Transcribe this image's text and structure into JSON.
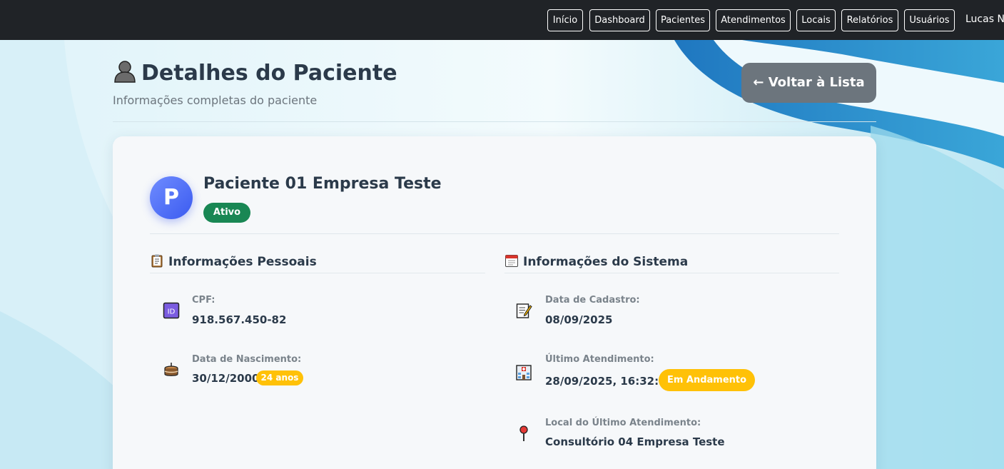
{
  "navbar": {
    "items": [
      {
        "label": "Início"
      },
      {
        "label": "Dashboard"
      },
      {
        "label": "Pacientes"
      },
      {
        "label": "Atendimentos"
      },
      {
        "label": "Locais"
      },
      {
        "label": "Relatórios"
      },
      {
        "label": "Usuários"
      }
    ],
    "user_name": "Lucas N"
  },
  "header": {
    "title": "Detalhes do Paciente",
    "subtitle": "Informações completas do paciente",
    "back_button": "← Voltar à Lista",
    "title_icon": "person-icon"
  },
  "patient": {
    "avatar_letter": "P",
    "name": "Paciente 01 Empresa Teste",
    "status": "Ativo",
    "status_color": "#198754"
  },
  "personal_info": {
    "title": "Informações Pessoais",
    "icon": "clipboard-icon",
    "cpf_label": "CPF:",
    "cpf_value": "918.567.450-82",
    "cpf_icon": "id-icon",
    "birth_label": "Data de Nascimento:",
    "birth_value": "30/12/2000",
    "birth_icon": "cake-icon",
    "age_badge": "24 anos"
  },
  "system_info": {
    "title": "Informações do Sistema",
    "icon": "calendar-icon",
    "created_label": "Data de Cadastro:",
    "created_value": "08/09/2025",
    "created_icon": "memo-icon",
    "last_attend_label": "Último Atendimento:",
    "last_attend_value": "28/09/2025, 16:32:00",
    "last_attend_icon": "hospital-icon",
    "last_attend_status": "Em Andamento",
    "last_location_label": "Local do Último Atendimento:",
    "last_location_value": "Consultório 04 Empresa Teste",
    "last_location_icon": "pushpin-icon"
  },
  "colors": {
    "navbar_bg": "#202327",
    "accent_blue": "#3b5bf0",
    "warning": "#ffc107",
    "secondary": "#6c757d"
  }
}
